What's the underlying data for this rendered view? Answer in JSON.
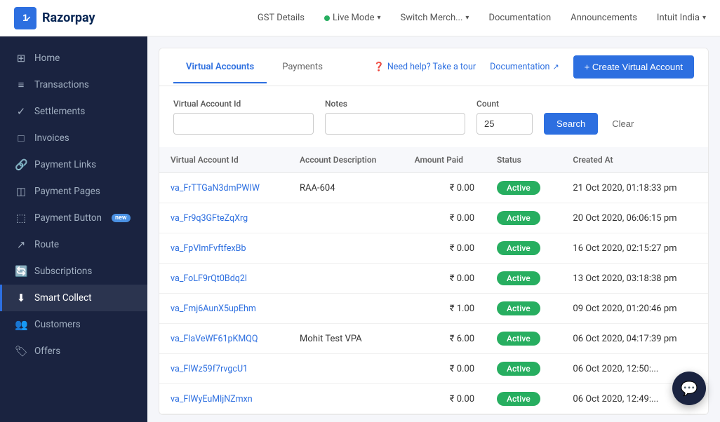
{
  "topnav": {
    "logo_text": "Razorpay",
    "logo_icon": "R",
    "items": [
      {
        "id": "gst",
        "label": "GST Details",
        "has_dot": false,
        "has_chevron": false
      },
      {
        "id": "live_mode",
        "label": "Live Mode",
        "has_dot": true,
        "has_chevron": true
      },
      {
        "id": "switch_merch",
        "label": "Switch Merch...",
        "has_dot": false,
        "has_chevron": true
      },
      {
        "id": "documentation",
        "label": "Documentation",
        "has_dot": false,
        "has_chevron": false
      },
      {
        "id": "announcements",
        "label": "Announcements",
        "has_dot": false,
        "has_chevron": false
      },
      {
        "id": "intuit_india",
        "label": "Intuit India",
        "has_dot": false,
        "has_chevron": true
      }
    ]
  },
  "sidebar": {
    "items": [
      {
        "id": "home",
        "label": "Home",
        "icon": "🏠",
        "active": false
      },
      {
        "id": "transactions",
        "label": "Transactions",
        "icon": "📋",
        "active": false
      },
      {
        "id": "settlements",
        "label": "Settlements",
        "icon": "✓",
        "active": false
      },
      {
        "id": "invoices",
        "label": "Invoices",
        "icon": "📄",
        "active": false
      },
      {
        "id": "payment_links",
        "label": "Payment Links",
        "icon": "🔗",
        "active": false
      },
      {
        "id": "payment_pages",
        "label": "Payment Pages",
        "icon": "📑",
        "active": false
      },
      {
        "id": "payment_button",
        "label": "Payment Button",
        "icon": "🔲",
        "active": false,
        "badge": "new"
      },
      {
        "id": "route",
        "label": "Route",
        "icon": "↗",
        "active": false
      },
      {
        "id": "subscriptions",
        "label": "Subscriptions",
        "icon": "🔄",
        "active": false
      },
      {
        "id": "smart_collect",
        "label": "Smart Collect",
        "icon": "⬇",
        "active": true
      },
      {
        "id": "customers",
        "label": "Customers",
        "icon": "👥",
        "active": false
      },
      {
        "id": "offers",
        "label": "Offers",
        "icon": "🏷",
        "active": false
      }
    ]
  },
  "tabs": [
    {
      "id": "virtual_accounts",
      "label": "Virtual Accounts",
      "active": true
    },
    {
      "id": "payments",
      "label": "Payments",
      "active": false
    }
  ],
  "help_link": "Need help? Take a tour",
  "doc_link": "Documentation",
  "create_btn_label": "+ Create Virtual Account",
  "filters": {
    "va_id_label": "Virtual Account Id",
    "va_id_value": "",
    "va_id_placeholder": "",
    "notes_label": "Notes",
    "notes_value": "",
    "notes_placeholder": "",
    "count_label": "Count",
    "count_value": "25",
    "search_label": "Search",
    "clear_label": "Clear"
  },
  "table": {
    "headers": [
      "Virtual Account Id",
      "Account Description",
      "Amount Paid",
      "Status",
      "Created At"
    ],
    "rows": [
      {
        "id": "va_FrTTGaN3dmPWIW",
        "description": "RAA-604",
        "amount": "₹ 0.00",
        "status": "Active",
        "created_at": "21 Oct 2020, 01:18:33 pm"
      },
      {
        "id": "va_Fr9q3GFteZqXrg",
        "description": "",
        "amount": "₹ 0.00",
        "status": "Active",
        "created_at": "20 Oct 2020, 06:06:15 pm"
      },
      {
        "id": "va_FpVlmFvftfexBb",
        "description": "",
        "amount": "₹ 0.00",
        "status": "Active",
        "created_at": "16 Oct 2020, 02:15:27 pm"
      },
      {
        "id": "va_FoLF9rQt0Bdq2l",
        "description": "",
        "amount": "₹ 0.00",
        "status": "Active",
        "created_at": "13 Oct 2020, 03:18:38 pm"
      },
      {
        "id": "va_Fmj6AunX5upEhm",
        "description": "",
        "amount": "₹ 1.00",
        "status": "Active",
        "created_at": "09 Oct 2020, 01:20:46 pm"
      },
      {
        "id": "va_FlaVeWF61pKMQQ",
        "description": "Mohit Test VPA",
        "amount": "₹ 6.00",
        "status": "Active",
        "created_at": "06 Oct 2020, 04:17:39 pm"
      },
      {
        "id": "va_FlWz59f7rvgcU1",
        "description": "",
        "amount": "₹ 0.00",
        "status": "Active",
        "created_at": "06 Oct 2020, 12:50:..."
      },
      {
        "id": "va_FlWyEuMljNZmxn",
        "description": "",
        "amount": "₹ 0.00",
        "status": "Active",
        "created_at": "06 Oct 2020, 12:49:..."
      }
    ]
  },
  "chat_icon": "💬"
}
